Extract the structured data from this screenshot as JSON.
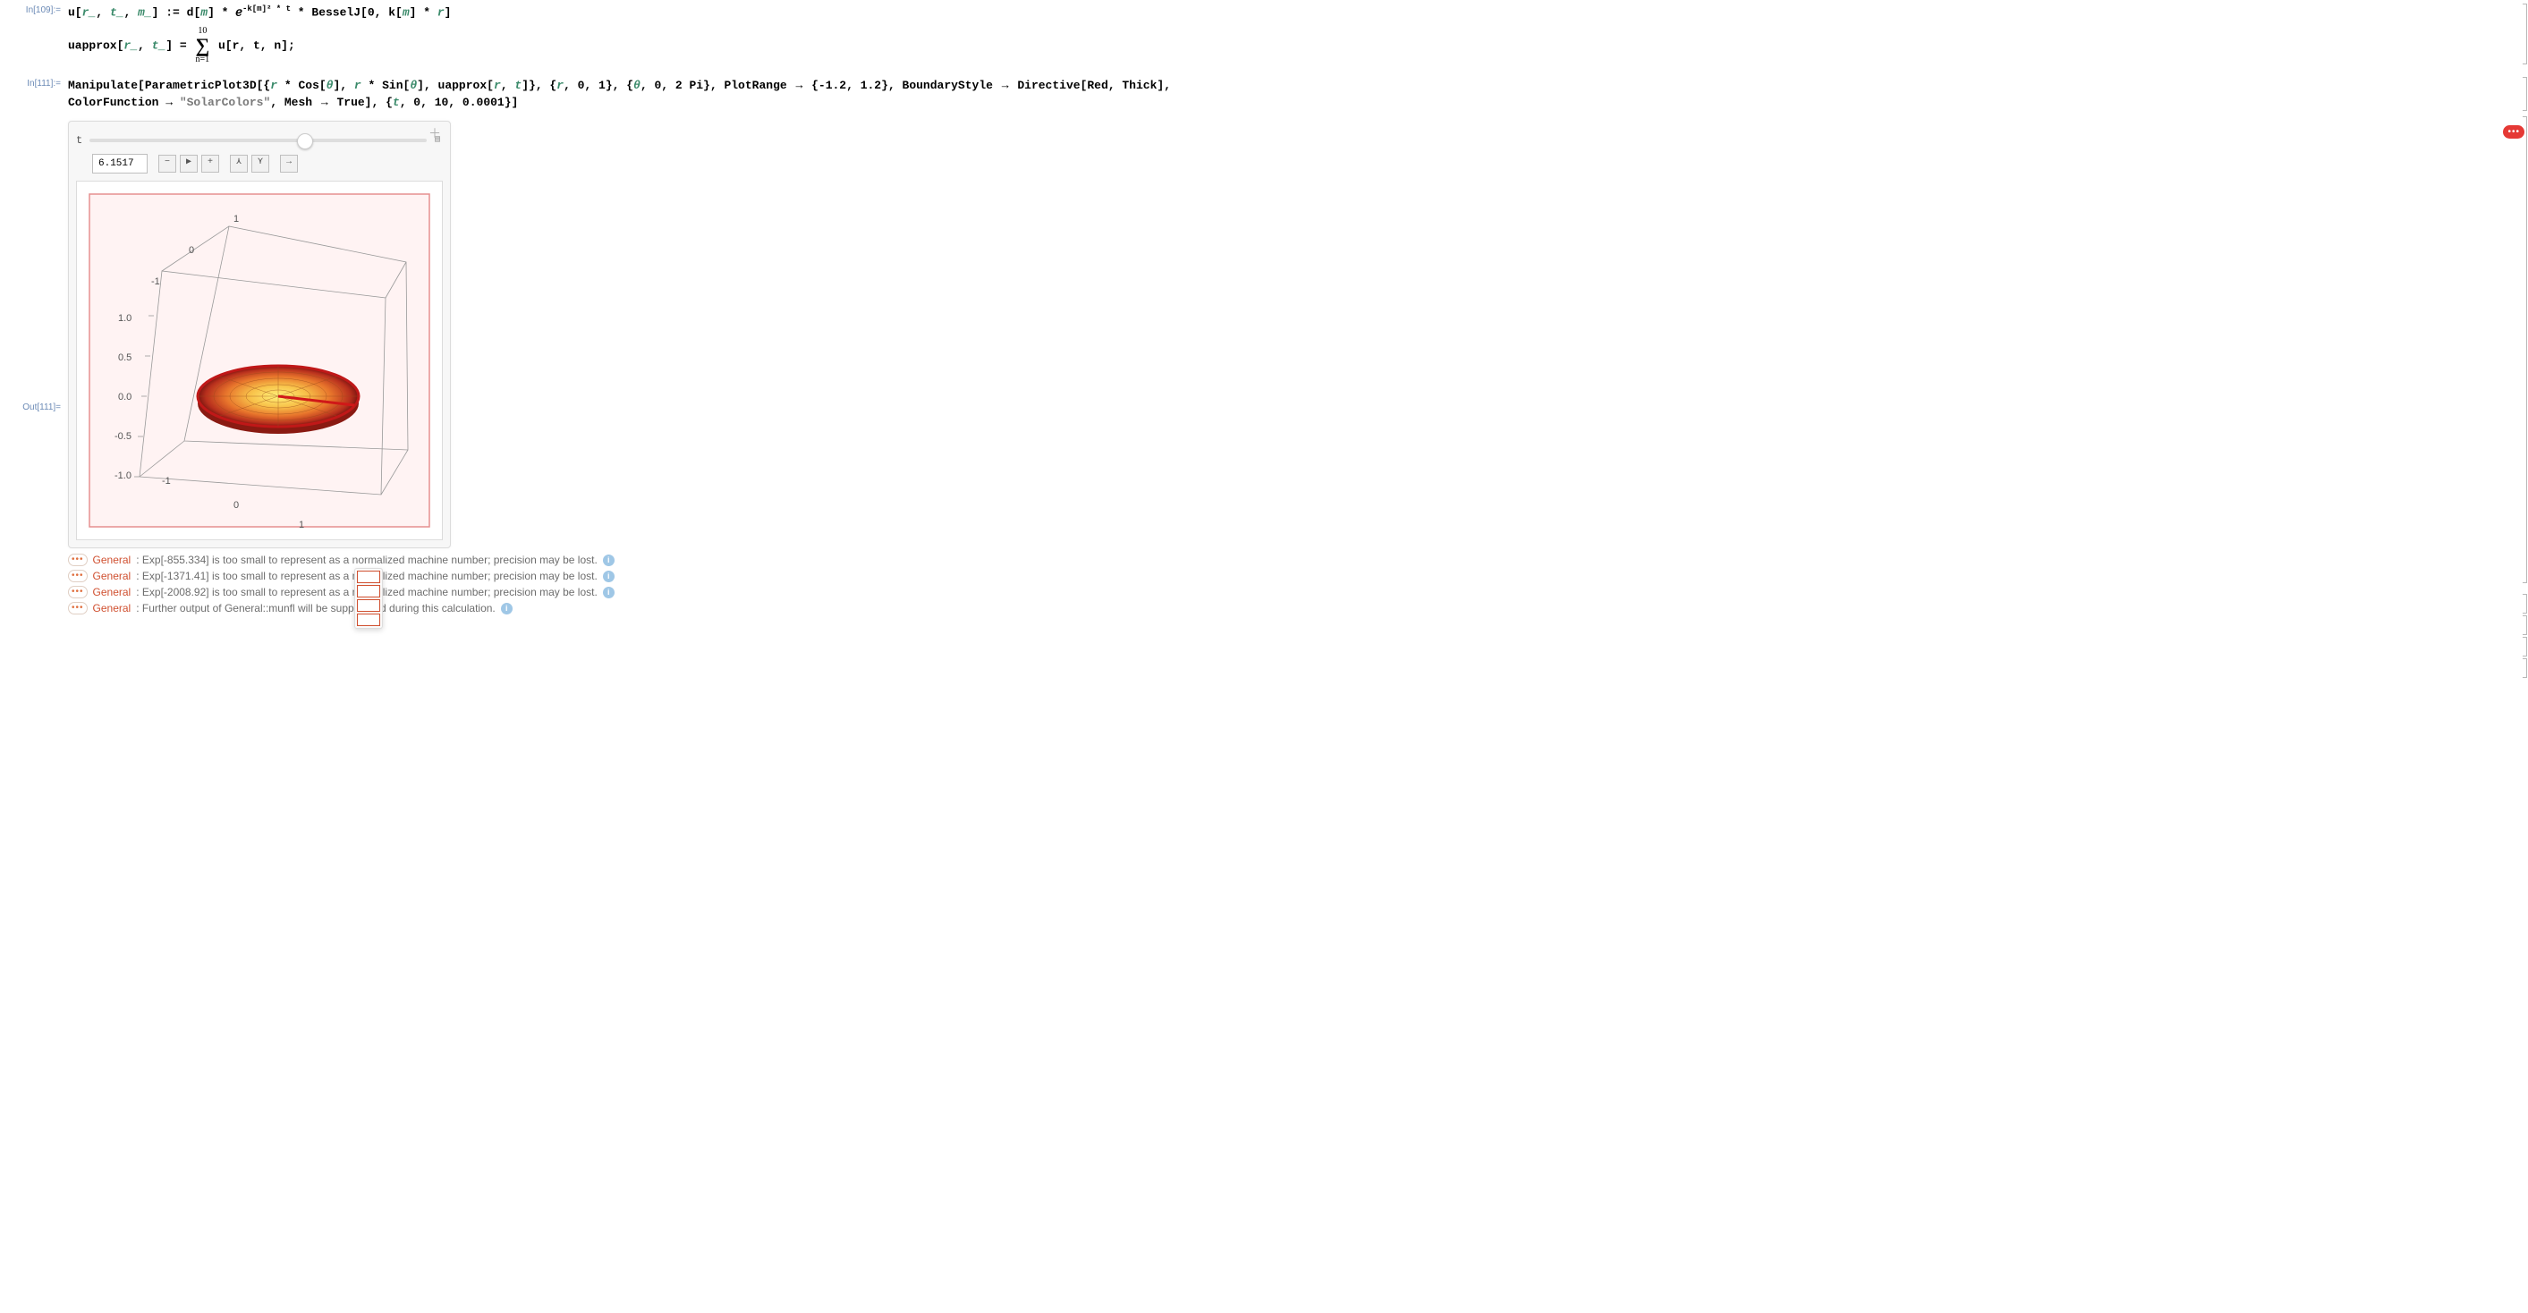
{
  "cells": {
    "in109_label": "In[109]:=",
    "in109_line1_parts": {
      "a": "u[",
      "r": "r_",
      "c1": ", ",
      "t": "t_",
      "c2": ", ",
      "m": "m_",
      "b": "] := d[",
      "mi": "m",
      "c": "] * ℯ",
      "exp": "-k[m]² * t",
      "d": " * BesselJ[0, k[",
      "mi2": "m",
      "e": "] * ",
      "ri": "r",
      "f": "]"
    },
    "in109_line2_parts": {
      "a": "uapprox[",
      "r": "r_",
      "c1": ", ",
      "t": "t_",
      "b": "] = ",
      "sum_top": "10",
      "sum_bot": "n=1",
      "c": "u[r, t, n];"
    },
    "in111_label": "In[111]:=",
    "in111_line1": "Manipulate[ParametricPlot3D[{r * Cos[θ], r * Sin[θ], uapprox[r, t]}, {r, 0, 1}, {θ, 0, 2 Pi}, PlotRange → {-1.2, 1.2}, BoundaryStyle → Directive[Red, Thick],",
    "in111_line2_a": " ColorFunction → ",
    "in111_line2_str": "\"SolarColors\"",
    "in111_line2_b": ", Mesh → True], {t, 0, 10, 0.0001}]",
    "out111_label": "Out[111]="
  },
  "manipulate": {
    "var_label": "t",
    "slider_fraction": 0.615,
    "value": "6.1517",
    "buttons": [
      "−",
      "▶",
      "+",
      "⋏",
      "⋎",
      "→"
    ],
    "plus_icon": "＋"
  },
  "axis_ticks": {
    "top_back": [
      "1",
      "0",
      "-1"
    ],
    "z": [
      "1.0",
      "0.5",
      "0.0",
      "-0.5",
      "-1.0"
    ],
    "bottom_front": [
      "-1",
      "0",
      "1"
    ]
  },
  "messages": [
    {
      "tag": "General",
      "body_a": ": Exp[-855.334] is too small to represent as a normalized machine number; precision may be lost. "
    },
    {
      "tag": "General",
      "body_a": ": Exp[-1371.41] is too small to represent as a normalized machine number; precision may be lost. "
    },
    {
      "tag": "General",
      "body_a": ": Exp[-2008.92] is too small to represent as a normalized machine number; precision may be lost. "
    },
    {
      "tag": "General",
      "body_a": ": Further output of General::munfl will be suppressed during this calculation. "
    }
  ],
  "pill": "•••",
  "chart_data": {
    "type": "other",
    "description": "ParametricPlot3D of a radially symmetric surface (sum of 10 Bessel modes) over the unit disk at t=6.1517, colored with SolarColors, red thick boundary, mesh on.",
    "params": {
      "r_range": [
        0,
        1
      ],
      "theta_range": [
        0,
        6.2832
      ],
      "z_plotrange": [
        -1.2,
        1.2
      ],
      "t": 6.1517
    },
    "z_axis_ticks": [
      -1.0,
      -0.5,
      0.0,
      0.5,
      1.0
    ],
    "xy_axis_ticks": [
      -1,
      0,
      1
    ]
  }
}
